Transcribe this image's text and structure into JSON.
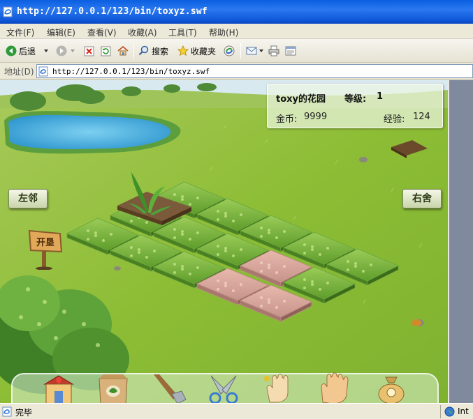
{
  "window": {
    "title": "http://127.0.0.1/123/bin/toxyz.swf"
  },
  "menu": [
    {
      "label": "文件(F)"
    },
    {
      "label": "编辑(E)"
    },
    {
      "label": "查看(V)"
    },
    {
      "label": "收藏(A)"
    },
    {
      "label": "工具(T)"
    },
    {
      "label": "帮助(H)"
    }
  ],
  "toolbar": {
    "back_label": "后退",
    "search_label": "搜索",
    "favorites_label": "收藏夹"
  },
  "address": {
    "label": "地址(D)",
    "url": "http://127.0.0.1/123/bin/toxyz.swf"
  },
  "game": {
    "garden_name": "toxy的花园",
    "level_label": "等级:",
    "level": "1",
    "gold_label": "金币:",
    "gold": "9999",
    "exp_label": "经验:",
    "exp": "124",
    "left_neighbor": "左邻",
    "right_neighbor": "右舍",
    "reclaim_sign": "开垦"
  },
  "status": {
    "text": "完毕",
    "zone": "Int"
  },
  "colors": {
    "titlebar": "#0a5fe0",
    "grass": "#8fbf3a",
    "plot_green": "#78b43c",
    "plot_soil": "#d9a59a"
  }
}
